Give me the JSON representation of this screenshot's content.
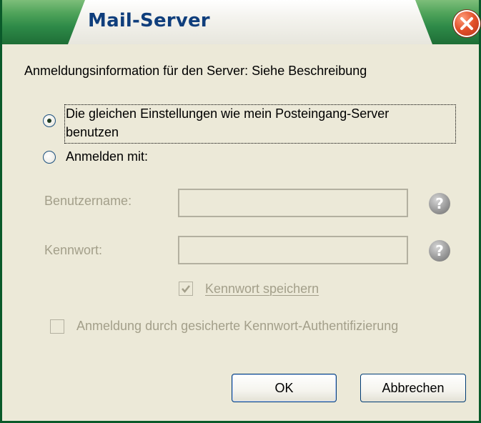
{
  "window": {
    "title": "Mail-Server"
  },
  "intro": "Anmeldungsinformation für den Server: Siehe Beschreibung",
  "options": {
    "same_settings_line1": "Die gleichen Einstellungen wie mein Posteingang-Server",
    "same_settings_line2": "benutzen",
    "login_with": "Anmelden mit:"
  },
  "fields": {
    "username_label": "Benutzername:",
    "username_value": "",
    "password_label": "Kennwort:",
    "password_value": ""
  },
  "checkboxes": {
    "save_password": "Kennwort speichern",
    "spa": "Anmeldung durch gesicherte Kennwort-Authentifizierung"
  },
  "buttons": {
    "ok": "OK",
    "cancel": "Abbrechen"
  },
  "icons": {
    "help": "?",
    "close": "close-icon"
  },
  "colors": {
    "title_text": "#0F3E7C",
    "dialog_bg": "#ECE9D8",
    "disabled_text": "#A39F8A"
  }
}
